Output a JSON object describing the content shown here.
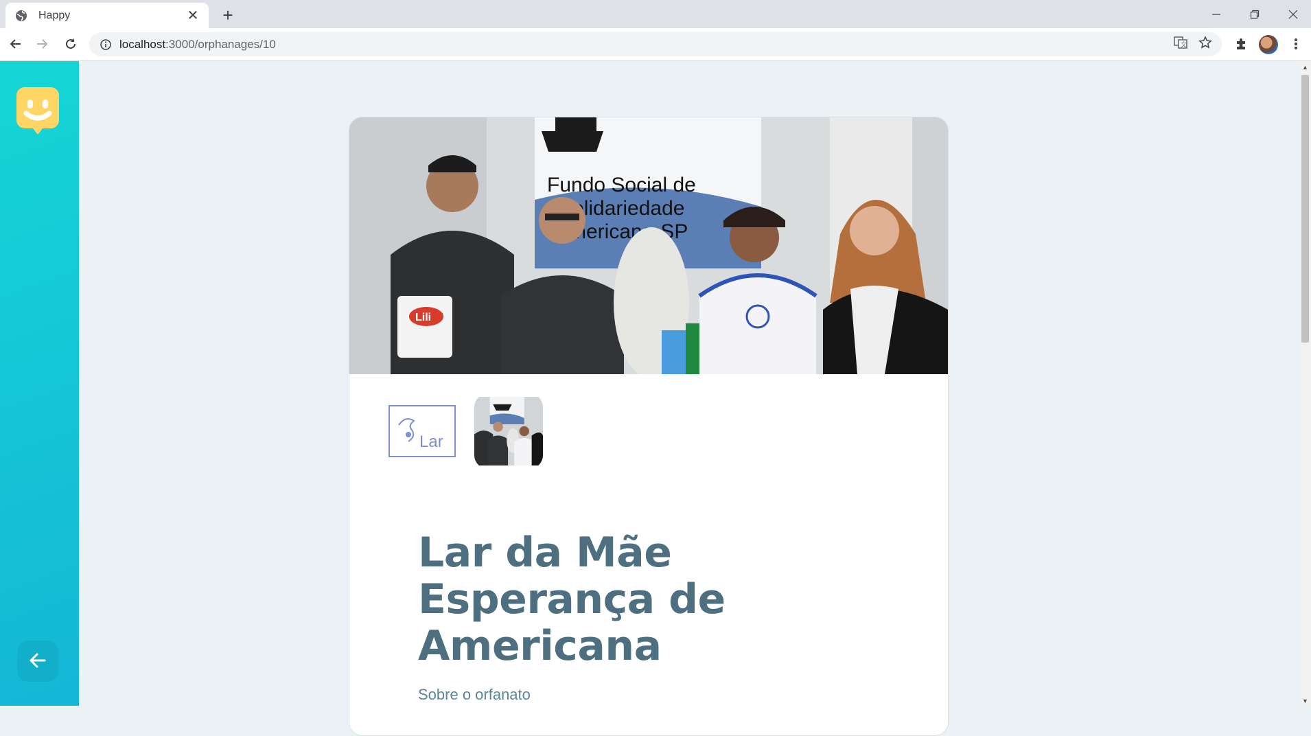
{
  "browser": {
    "tab_title": "Happy",
    "url_host": "localhost",
    "url_path": ":3000/orphanages/10"
  },
  "sidebar": {
    "logo_icon": "happy-face-logo-icon",
    "back_icon": "arrow-left-icon"
  },
  "orphanage": {
    "name": "Lar da Mãe Esperança de Americana",
    "section_heading": "Sobre o orfanato",
    "photo_banner": {
      "line1": "Fundo Social de",
      "line2": "Solidariedade",
      "line3": "Americana-SP"
    },
    "bag_label": "Lili",
    "thumb_logo_text": "Lar",
    "thumbnails_count": 2
  },
  "colors": {
    "sidebar_start": "#15d6d6",
    "sidebar_end": "#15b6d6",
    "title": "#4d6f80",
    "logo": "#ffd666"
  }
}
